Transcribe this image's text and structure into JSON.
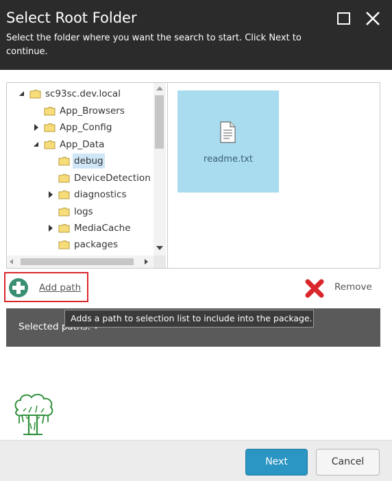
{
  "dialog": {
    "title": "Select Root Folder",
    "subtitle": "Select the folder where you want the search to start. Click Next to continue.",
    "maximize_icon": "maximize-icon",
    "close_icon": "close-icon"
  },
  "tree": {
    "nodes": [
      {
        "label": "sc93sc.dev.local",
        "arrow": "expanded"
      },
      {
        "label": "App_Browsers",
        "arrow": "none"
      },
      {
        "label": "App_Config",
        "arrow": "collapsed"
      },
      {
        "label": "App_Data",
        "arrow": "expanded"
      },
      {
        "label": "debug",
        "arrow": "none",
        "selected": true
      },
      {
        "label": "DeviceDetection",
        "arrow": "none"
      },
      {
        "label": "diagnostics",
        "arrow": "collapsed"
      },
      {
        "label": "logs",
        "arrow": "none"
      },
      {
        "label": "MediaCache",
        "arrow": "collapsed"
      },
      {
        "label": "packages",
        "arrow": "none"
      }
    ]
  },
  "files": [
    {
      "name": "readme.txt",
      "icon": "text-file-icon"
    }
  ],
  "actions": {
    "add_path": "Add path",
    "remove": "Remove"
  },
  "tooltip": "Adds a path to selection list to include into the package.",
  "selected_paths": {
    "label": "Selected paths:"
  },
  "footer": {
    "next": "Next",
    "cancel": "Cancel"
  },
  "colors": {
    "header_bg": "#2b2b2b",
    "tile_bg": "#a9dcef",
    "selection_bg": "#cfe6f7",
    "next_button": "#2b95c3",
    "highlight_box": "#d8262b",
    "remove_icon": "#d9262b",
    "add_icon": "#3a8f73"
  }
}
